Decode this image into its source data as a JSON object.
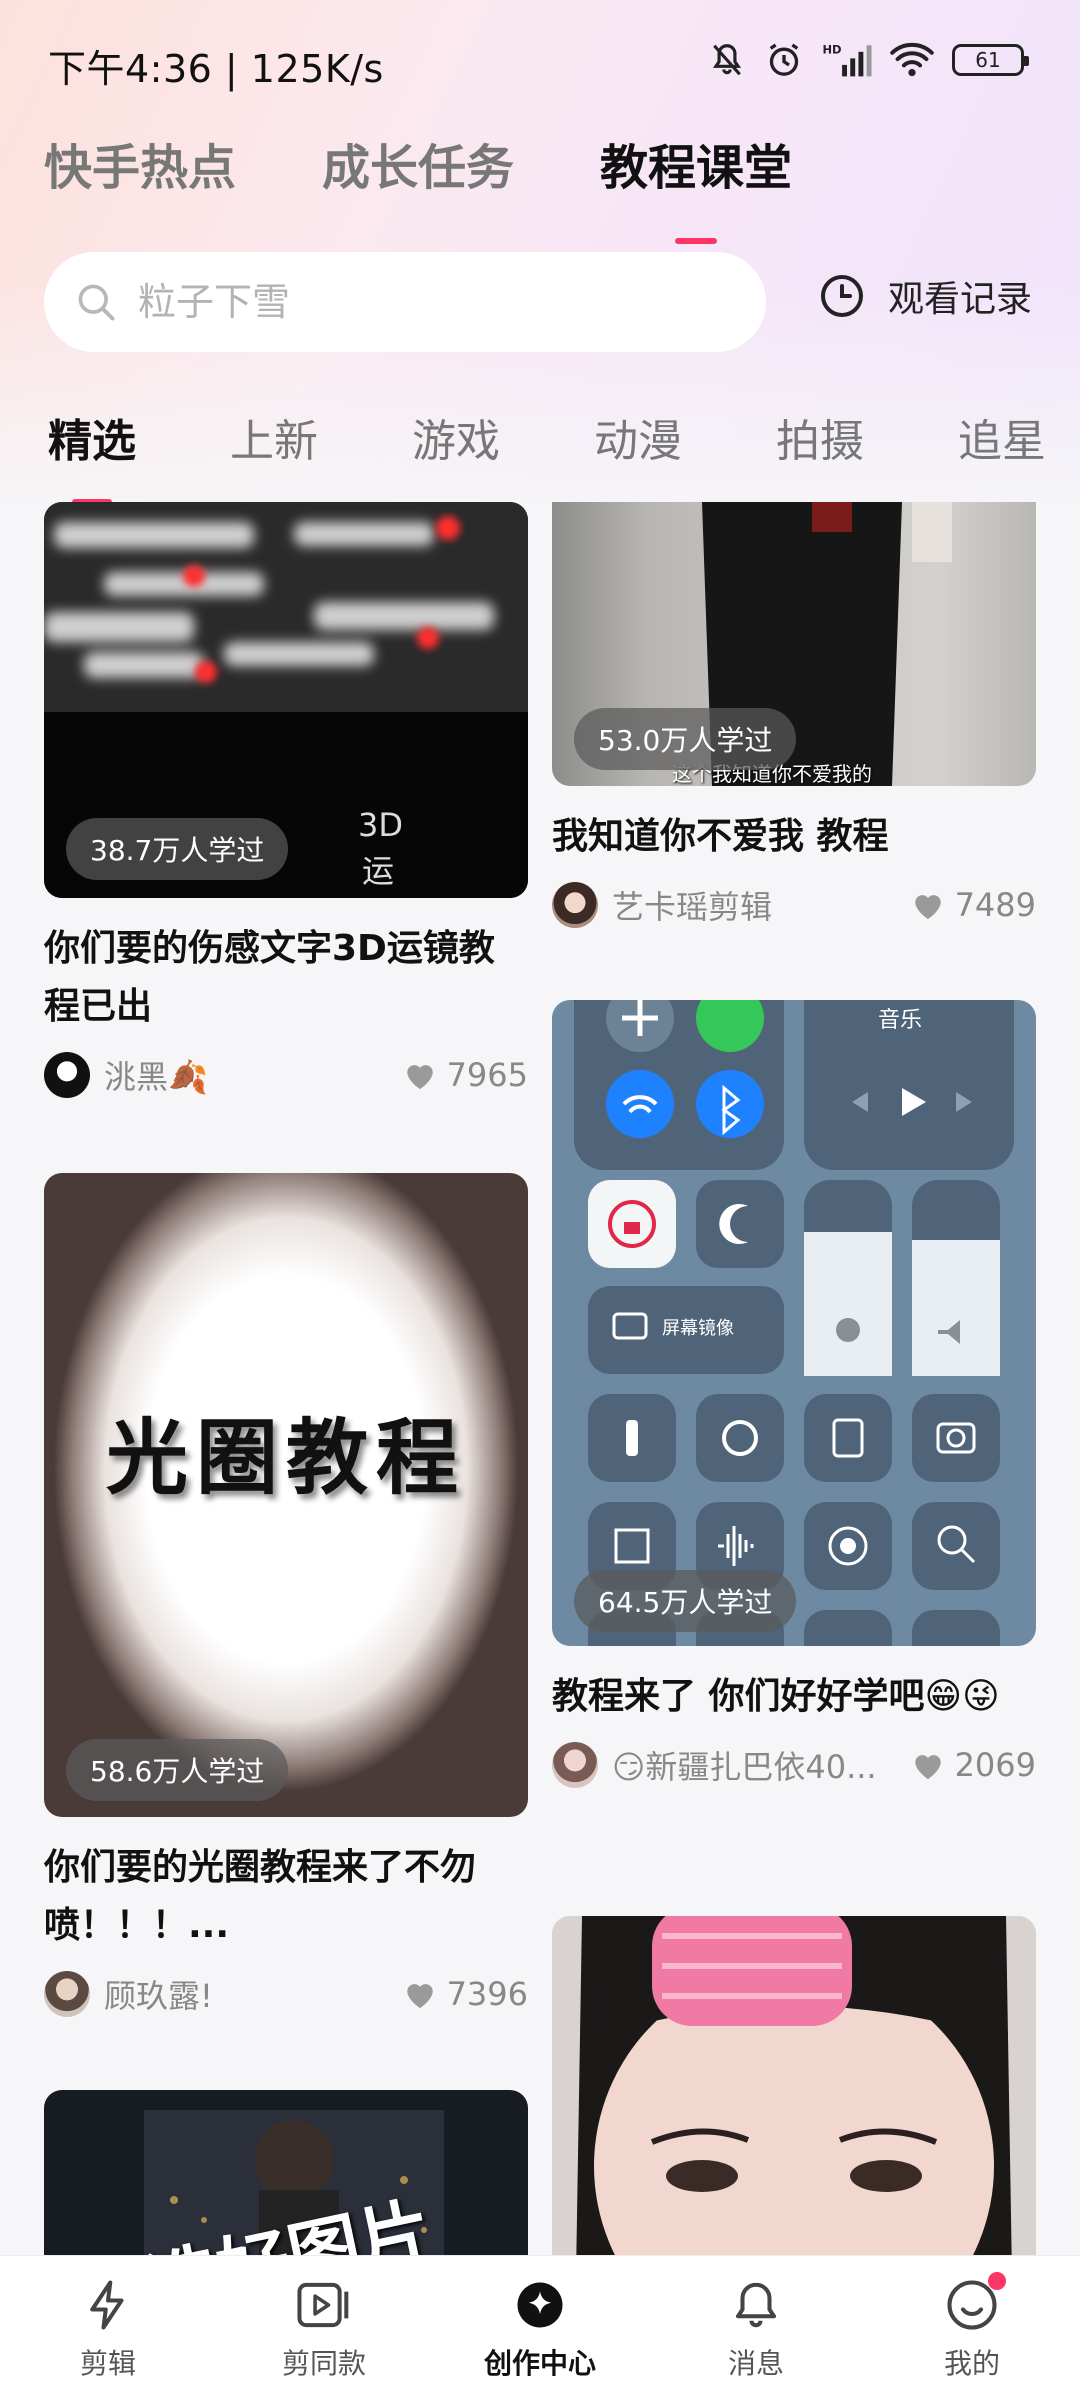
{
  "status_bar": {
    "time": "下午4:36 | 125K/s",
    "battery": "61"
  },
  "top_tabs": [
    {
      "label": "快手热点",
      "active": false
    },
    {
      "label": "成长任务",
      "active": false
    },
    {
      "label": "教程课堂",
      "active": true
    }
  ],
  "search": {
    "placeholder": "粒子下雪"
  },
  "history": {
    "label": "观看记录"
  },
  "categories": [
    {
      "label": "精选",
      "active": true
    },
    {
      "label": "上新",
      "active": false
    },
    {
      "label": "游戏",
      "active": false
    },
    {
      "label": "动漫",
      "active": false
    },
    {
      "label": "拍摄",
      "active": false
    },
    {
      "label": "追星",
      "active": false
    }
  ],
  "feed": {
    "left": [
      {
        "views": "38.7万人学过",
        "thumb_text": "3D\n运",
        "title": "你们要的伤感文字3D运镜教程已出",
        "author": "洮黑🍂",
        "likes": "7965"
      },
      {
        "views": "58.6万人学过",
        "thumb_text": "光圈教程",
        "title": "你们要的光圈教程来了不勿喷！！！...",
        "author": "顾玖露!",
        "likes": "7396"
      },
      {
        "thumb_text": "选好图片"
      }
    ],
    "right": [
      {
        "views": "53.0万人学过",
        "thumb_text": "这个我知道你不爱我的",
        "title": "我知道你不爱我 教程",
        "author": "艺卡瑶剪辑",
        "likes": "7489"
      },
      {
        "views": "64.5万人学过",
        "thumb_text": "音乐",
        "thumb_text2": "屏幕镜像",
        "title": "教程来了 你们好好学吧😁😜",
        "author": "😏新疆扎巴依40...",
        "likes": "2069"
      },
      {}
    ]
  },
  "bottom_nav": [
    {
      "label": "剪辑",
      "icon": "lightning-icon",
      "active": false
    },
    {
      "label": "剪同款",
      "icon": "video-template-icon",
      "active": false
    },
    {
      "label": "创作中心",
      "icon": "creation-center-icon",
      "active": true
    },
    {
      "label": "消息",
      "icon": "bell-icon",
      "active": false,
      "badge": false
    },
    {
      "label": "我的",
      "icon": "profile-smile-icon",
      "active": false,
      "badge": true
    }
  ],
  "colors": {
    "accent": "#fe3666",
    "text": "#111111",
    "muted": "#888888"
  }
}
